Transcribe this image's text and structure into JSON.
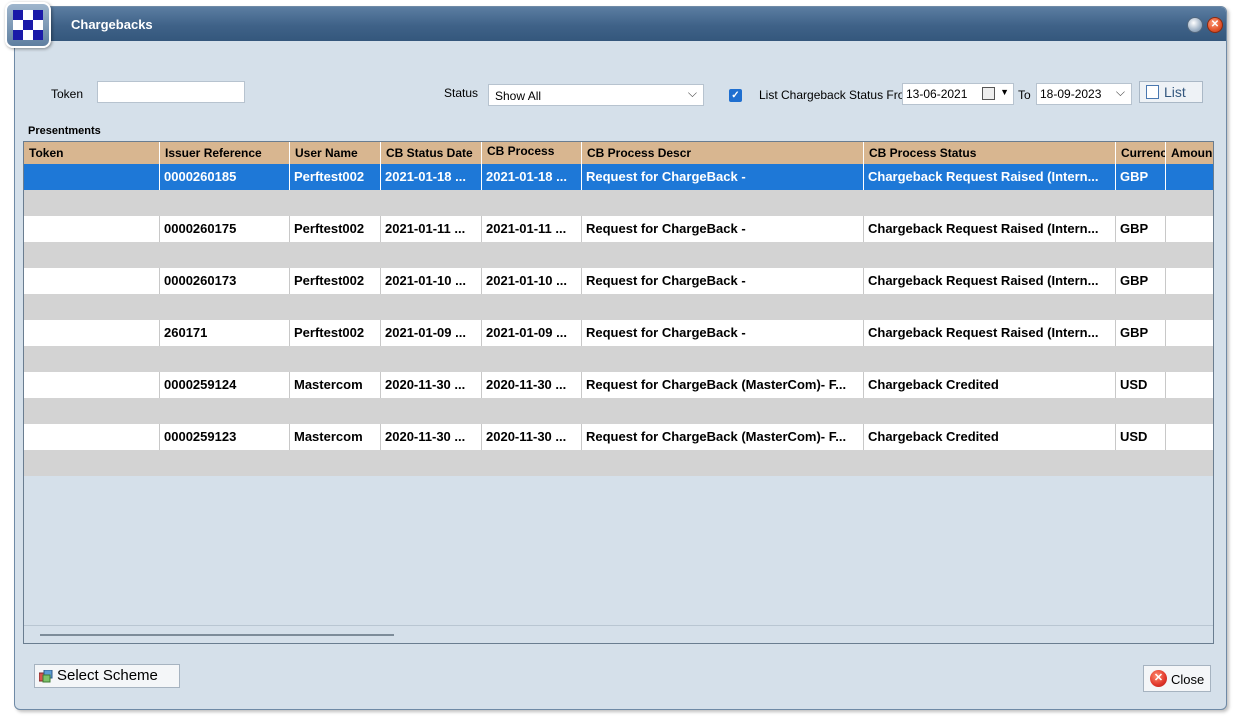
{
  "window": {
    "title": "Chargebacks"
  },
  "filters": {
    "token_label": "Token",
    "token_value": "",
    "status_label": "Status",
    "status_value": "Show All",
    "list_status_checkbox_checked": true,
    "list_status_label": "List Chargeback Status From",
    "date_from": "13-06-2021",
    "to_label": "To",
    "date_to": "18-09-2023",
    "list_button_label": "List"
  },
  "section_title": "Presentments",
  "table": {
    "columns": [
      "Token",
      "Issuer Reference",
      "User Name",
      "CB Status Date",
      "CB Process",
      "CB Process Descr",
      "CB Process Status",
      "Currency",
      "Amoun"
    ],
    "rows": [
      {
        "token": "",
        "issuer_reference": "0000260185",
        "user_name": "Perftest002",
        "cb_status_date": "2021-01-18 ...",
        "cb_process": "2021-01-18 ...",
        "cb_process_descr": "Request for ChargeBack -",
        "cb_process_status": "Chargeback Request Raised (Intern...",
        "currency": "GBP",
        "amount": "",
        "selected": true
      },
      {
        "token": "",
        "issuer_reference": "0000260175",
        "user_name": "Perftest002",
        "cb_status_date": "2021-01-11 ...",
        "cb_process": "2021-01-11 ...",
        "cb_process_descr": "Request for ChargeBack -",
        "cb_process_status": "Chargeback Request Raised (Intern...",
        "currency": "GBP",
        "amount": "",
        "selected": false
      },
      {
        "token": "",
        "issuer_reference": "0000260173",
        "user_name": "Perftest002",
        "cb_status_date": "2021-01-10 ...",
        "cb_process": "2021-01-10 ...",
        "cb_process_descr": "Request for ChargeBack -",
        "cb_process_status": "Chargeback Request Raised (Intern...",
        "currency": "GBP",
        "amount": "",
        "selected": false
      },
      {
        "token": "",
        "issuer_reference": "260171",
        "user_name": "Perftest002",
        "cb_status_date": "2021-01-09 ...",
        "cb_process": "2021-01-09 ...",
        "cb_process_descr": "Request for ChargeBack -",
        "cb_process_status": "Chargeback Request Raised (Intern...",
        "currency": "GBP",
        "amount": "",
        "selected": false
      },
      {
        "token": "",
        "issuer_reference": "0000259124",
        "user_name": "Mastercom",
        "cb_status_date": "2020-11-30 ...",
        "cb_process": "2020-11-30 ...",
        "cb_process_descr": "Request for ChargeBack (MasterCom)- F...",
        "cb_process_status": "Chargeback Credited",
        "currency": "USD",
        "amount": "",
        "selected": false
      },
      {
        "token": "",
        "issuer_reference": "0000259123",
        "user_name": "Mastercom",
        "cb_status_date": "2020-11-30 ...",
        "cb_process": "2020-11-30 ...",
        "cb_process_descr": "Request for ChargeBack (MasterCom)- F...",
        "cb_process_status": "Chargeback Credited",
        "currency": "USD",
        "amount": "",
        "selected": false
      }
    ]
  },
  "footer": {
    "select_scheme_label": "Select Scheme",
    "close_label": "Close"
  },
  "colors": {
    "title_bar": "#3f6288",
    "window_bg": "#d5e0ea",
    "header_bg": "#d8b690",
    "selected_row": "#1e78d7",
    "stripe_row": "#d3d3d3"
  }
}
